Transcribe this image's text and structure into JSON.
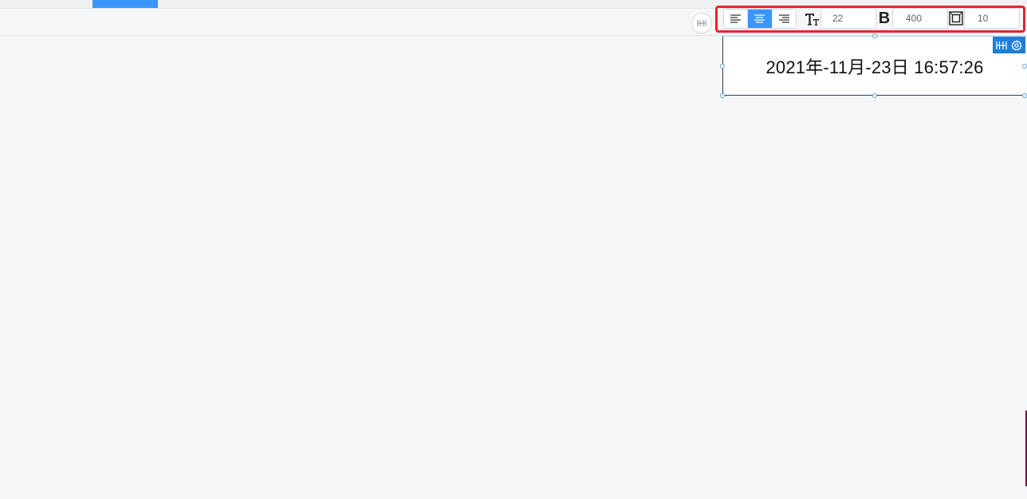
{
  "toolbar": {
    "align_options": [
      "left",
      "center",
      "right"
    ],
    "active_align": "center",
    "font_size": {
      "icon": "font-size-icon",
      "value": "22"
    },
    "font_weight": {
      "glyph": "B",
      "value": "400"
    },
    "padding": {
      "icon": "padding-icon",
      "value": "10"
    }
  },
  "widget": {
    "datetime_text": "2021年-11月-23日 16:57:26"
  },
  "colors": {
    "accent": "#3a95ff",
    "highlight_border": "#e8242b",
    "badge": "#1e7fd9",
    "canvas": "#f5f6f8"
  }
}
